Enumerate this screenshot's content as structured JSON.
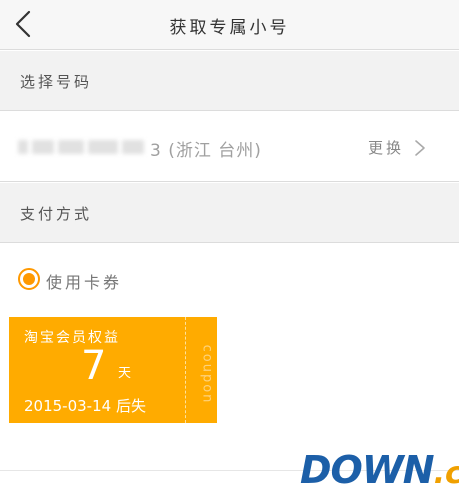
{
  "header": {
    "title": "获取专属小号"
  },
  "sections": {
    "select_number": "选择号码",
    "payment_method": "支付方式"
  },
  "number_row": {
    "visible_suffix": "3 (浙江 台州)",
    "change_label": "更换"
  },
  "payment": {
    "option_label": "使用卡券",
    "selected": true
  },
  "coupon": {
    "title": "淘宝会员权益",
    "days": "7",
    "unit": "天",
    "expiry": "2015-03-14 后失",
    "side_label": "coupon"
  },
  "watermark": {
    "main": "DOWN",
    "suffix": ".cc"
  },
  "colors": {
    "accent": "#ff9900",
    "coupon_bg": "#ffab00",
    "section_bg": "#f2f2f2",
    "watermark_blue": "#1c5fa8",
    "watermark_orange": "#f0a000"
  },
  "icons": {
    "back": "back-chevron-icon",
    "forward": "chevron-right-icon"
  }
}
